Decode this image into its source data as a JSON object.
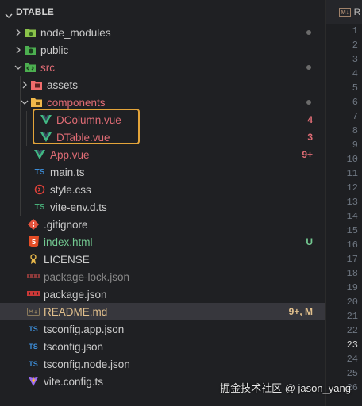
{
  "explorer": {
    "title": "DTABLE",
    "items": [
      {
        "label": "node_modules",
        "color": "#cccccc",
        "badge": "",
        "dot": true,
        "icon": "node-folder-icon"
      },
      {
        "label": "public",
        "color": "#cccccc",
        "badge": "",
        "dot": false,
        "icon": "public-folder-icon"
      },
      {
        "label": "src",
        "color": "#e06c75",
        "badge": "",
        "dot": true,
        "icon": "src-folder-icon"
      },
      {
        "label": "assets",
        "color": "#cccccc",
        "badge": "",
        "dot": false,
        "icon": "assets-folder-icon"
      },
      {
        "label": "components",
        "color": "#e06c75",
        "badge": "",
        "dot": true,
        "icon": "components-folder-icon"
      },
      {
        "label": "DColumn.vue",
        "color": "#e06c75",
        "badge": "4",
        "dot": false,
        "icon": "vue-icon"
      },
      {
        "label": "DTable.vue",
        "color": "#e06c75",
        "badge": "3",
        "dot": false,
        "icon": "vue-icon"
      },
      {
        "label": "App.vue",
        "color": "#e06c75",
        "badge": "9+",
        "dot": false,
        "icon": "vue-icon"
      },
      {
        "label": "main.ts",
        "color": "#cccccc",
        "badge": "",
        "dot": false,
        "icon": "typescript-icon"
      },
      {
        "label": "style.css",
        "color": "#cccccc",
        "badge": "",
        "dot": false,
        "icon": "css-icon"
      },
      {
        "label": "vite-env.d.ts",
        "color": "#cccccc",
        "badge": "",
        "dot": false,
        "icon": "typescript-def-icon"
      },
      {
        "label": ".gitignore",
        "color": "#cccccc",
        "badge": "",
        "dot": false,
        "icon": "git-icon"
      },
      {
        "label": "index.html",
        "color": "#73c991",
        "badge": "U",
        "dot": false,
        "icon": "html-icon"
      },
      {
        "label": "LICENSE",
        "color": "#cccccc",
        "badge": "",
        "dot": false,
        "icon": "license-icon"
      },
      {
        "label": "package-lock.json",
        "color": "#8b8b8b",
        "badge": "",
        "dot": false,
        "icon": "npm-icon"
      },
      {
        "label": "package.json",
        "color": "#cccccc",
        "badge": "",
        "dot": false,
        "icon": "npm-icon"
      },
      {
        "label": "README.md",
        "color": "#e2c08d",
        "badge": "9+, M",
        "dot": false,
        "icon": "markdown-icon"
      },
      {
        "label": "tsconfig.app.json",
        "color": "#cccccc",
        "badge": "",
        "dot": false,
        "icon": "tsconfig-icon"
      },
      {
        "label": "tsconfig.json",
        "color": "#cccccc",
        "badge": "",
        "dot": false,
        "icon": "tsconfig-icon"
      },
      {
        "label": "tsconfig.node.json",
        "color": "#cccccc",
        "badge": "",
        "dot": false,
        "icon": "tsconfig-icon"
      },
      {
        "label": "vite.config.ts",
        "color": "#cccccc",
        "badge": "",
        "dot": false,
        "icon": "vite-icon"
      }
    ]
  },
  "editor": {
    "tab_label": "R",
    "active_line": "23",
    "line_numbers": [
      "1",
      "2",
      "3",
      "4",
      "5",
      "6",
      "7",
      "8",
      "9",
      "10",
      "11",
      "12",
      "13",
      "14",
      "15",
      "16",
      "17",
      "18",
      "19",
      "20",
      "21",
      "22",
      "23",
      "24",
      "25",
      "26"
    ]
  },
  "watermark": "掘金技术社区 @ jason_yang",
  "colors": {
    "modified": "#e06c75",
    "untracked": "#73c991",
    "readme": "#e2c08d",
    "highlight": "#e3a43a"
  }
}
